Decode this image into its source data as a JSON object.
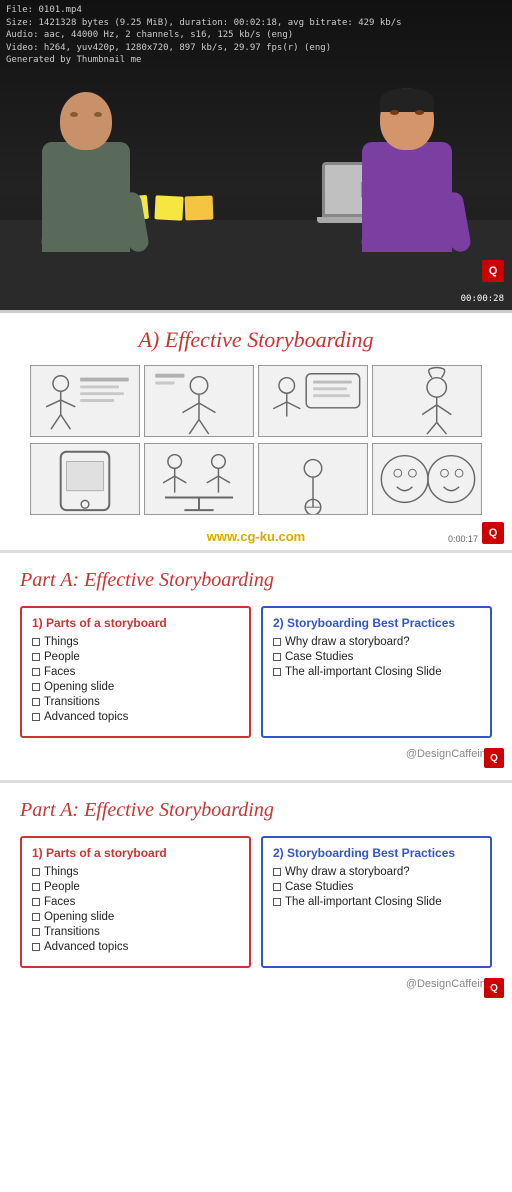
{
  "video": {
    "metadata_line1": "File: 0101.mp4",
    "metadata_line2": "Size: 1421328 bytes (9.25 MiB), duration: 00:02:18, avg bitrate: 429 kb/s",
    "metadata_line3": "Audio: aac, 44000 Hz, 2 channels, s16, 125 kb/s (eng)",
    "metadata_line4": "Video: h264, yuv420p, 1280x720, 897 kb/s, 29.97 fps(r) (eng)",
    "metadata_line5": "Generated by Thumbnail me",
    "timestamp": "00:00:28",
    "watermark": "Q"
  },
  "slide_a": {
    "title": "A) Effective Storyboarding",
    "url_overlay": "www.cg-ku.com",
    "timestamp": "0:00:17",
    "watermark": "Q"
  },
  "panel1": {
    "title": "Part A: Effective Storyboarding",
    "col_left_heading": "1) Parts of a storyboard",
    "col_left_items": [
      "Things",
      "People",
      "Faces",
      "Opening slide",
      "Transitions",
      "Advanced topics"
    ],
    "col_right_heading": "2) Storyboarding Best Practices",
    "col_right_items": [
      "Why draw a storyboard?",
      "Case Studies",
      "The all-important Closing Slide"
    ],
    "footer_credit": "@DesignCaffeine",
    "watermark": "Q"
  },
  "panel2": {
    "title": "Part A: Effective Storyboarding",
    "col_left_heading": "1) Parts of a storyboard",
    "col_left_items": [
      "Things",
      "People",
      "Faces",
      "Opening slide",
      "Transitions",
      "Advanced topics"
    ],
    "col_right_heading": "2) Storyboarding Best Practices",
    "col_right_items": [
      "Why draw a storyboard?",
      "Case Studies",
      "The all-important Closing Slide"
    ],
    "footer_credit": "@DesignCaffeine",
    "watermark": "Q"
  }
}
